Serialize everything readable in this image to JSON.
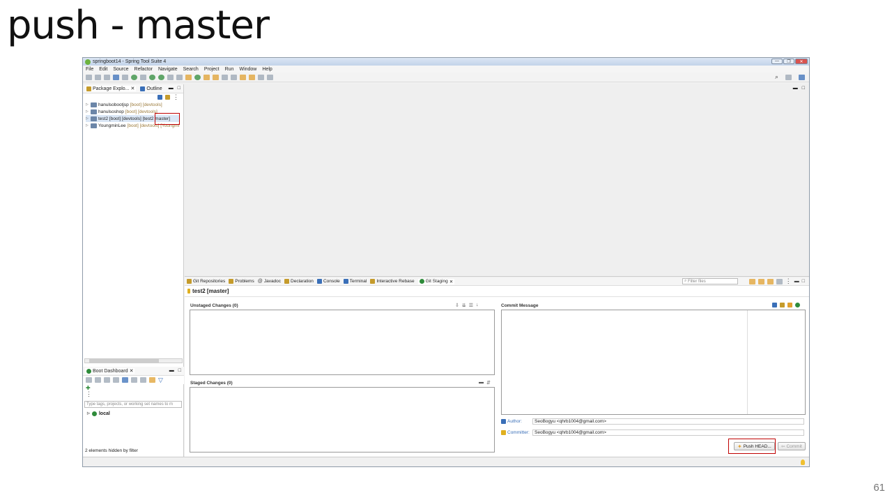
{
  "slide": {
    "title": "push - master",
    "page_number": "61"
  },
  "window": {
    "title": "springboot14 - Spring Tool Suite 4",
    "controls": [
      "—",
      "❐",
      "✕"
    ]
  },
  "menu": [
    "File",
    "Edit",
    "Source",
    "Refactor",
    "Navigate",
    "Search",
    "Project",
    "Run",
    "Window",
    "Help"
  ],
  "left_panel": {
    "tabs": [
      {
        "label": "Package Explo...",
        "close": "✕",
        "icon": "package-explorer-icon"
      },
      {
        "label": "Outline",
        "icon": "outline-icon"
      }
    ],
    "projects": [
      {
        "name": "hanulsobootjsp",
        "decoration": "[boot] [devtools]"
      },
      {
        "name": "hanulsoshop",
        "decoration": "[boot] [devtools]"
      },
      {
        "name": "test2 [boot] [devtools] [test2 master]",
        "decoration": ""
      },
      {
        "name": "YoungminLee",
        "decoration": "[boot] [devtools] [Youngmi"
      }
    ]
  },
  "boot_dashboard": {
    "tab_label": "Boot Dashboard",
    "close": "✕",
    "filter_placeholder": "Type tags, projects, or working set names to m",
    "local_label": "local",
    "hidden_text": "2 elements hidden by filter"
  },
  "bottom_panel": {
    "tabs": [
      "Git Repositories",
      "Problems",
      "Javadoc",
      "Declaration",
      "Console",
      "Terminal",
      "Interactive Rebase",
      "Git Staging"
    ],
    "close": "✕",
    "filter_placeholder": "Filter files",
    "repo_title": "test2 [master]",
    "unstaged_label": "Unstaged Changes (0)",
    "staged_label": "Staged Changes (0)",
    "commit_message_label": "Commit Message",
    "author_label": "Author:",
    "author_value": "SeoBogyu <qhrb1004@gmail.com>",
    "committer_label": "Committer:",
    "committer_value": "SeoBogyu <qhrb1004@gmail.com>",
    "push_button": "Push HEAD...",
    "commit_button": "Commit"
  },
  "colors": {
    "highlight": "#c00000",
    "accent": "#3a6fb8",
    "boot_green": "#2e8b3a"
  }
}
